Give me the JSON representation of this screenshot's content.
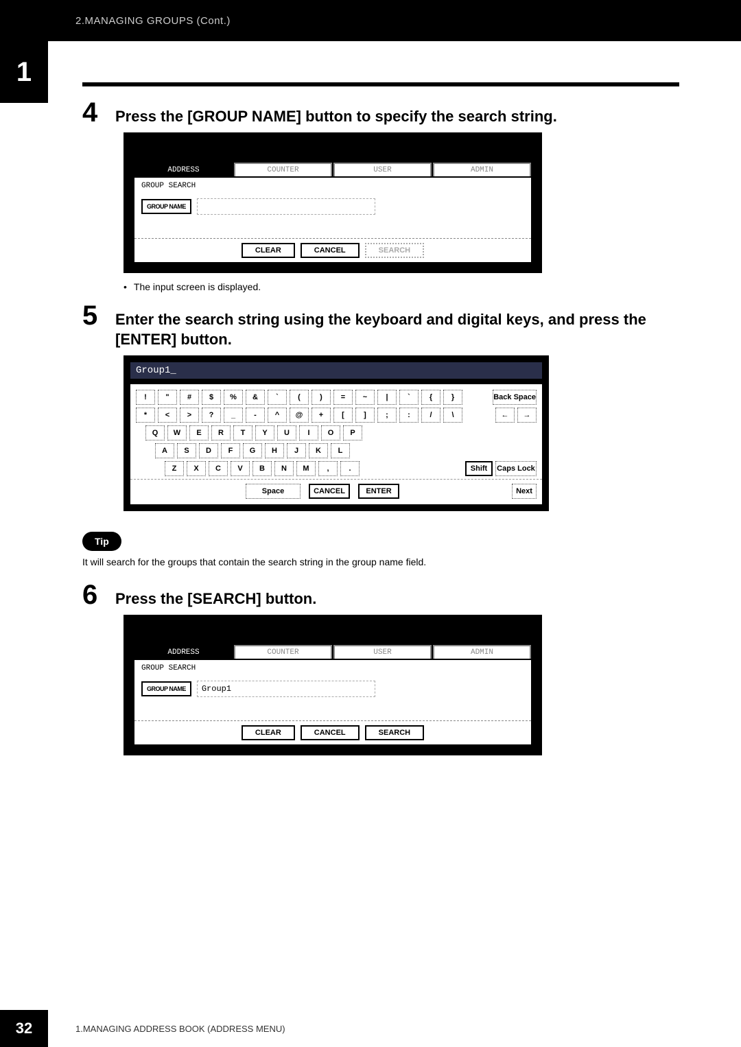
{
  "header": {
    "section_title": "2.MANAGING GROUPS (Cont.)"
  },
  "chapter_tab": "1",
  "steps": {
    "s4": {
      "num": "4",
      "text": "Press the [GROUP NAME] button to specify the search string."
    },
    "s5": {
      "num": "5",
      "text": "Enter the search string using the keyboard and digital keys, and press the [ENTER] button."
    },
    "s6": {
      "num": "6",
      "text": "Press the [SEARCH] button."
    }
  },
  "bullet_after_s4": "The input screen is displayed.",
  "tip": {
    "label": "Tip",
    "text": "It will search for the groups that contain the search string in the group name field."
  },
  "panel": {
    "tabs": {
      "address": "ADDRESS",
      "counter": "COUNTER",
      "user": "USER",
      "admin": "ADMIN"
    },
    "title": "GROUP SEARCH",
    "group_name_btn": "GROUP NAME",
    "group_name_value_empty": "",
    "group_name_value_filled": "Group1",
    "actions": {
      "clear": "CLEAR",
      "cancel": "CANCEL",
      "search": "SEARCH"
    }
  },
  "keyboard": {
    "input_value": "Group1_",
    "row1": [
      "!",
      "\"",
      "#",
      "$",
      "%",
      "&",
      "`",
      "(",
      ")",
      "=",
      "~",
      "|",
      "`",
      "{",
      "}"
    ],
    "row1_right": "Back Space",
    "row2": [
      "*",
      "<",
      ">",
      "?",
      "_",
      "-",
      "^",
      "@",
      "+",
      "[",
      "]",
      ";",
      ":",
      "/",
      "\\"
    ],
    "row2_right": [
      "←",
      "→"
    ],
    "row3": [
      "Q",
      "W",
      "E",
      "R",
      "T",
      "Y",
      "U",
      "I",
      "O",
      "P"
    ],
    "row4": [
      "A",
      "S",
      "D",
      "F",
      "G",
      "H",
      "J",
      "K",
      "L"
    ],
    "row5": [
      "Z",
      "X",
      "C",
      "V",
      "B",
      "N",
      "M",
      ",",
      "."
    ],
    "row5_right": [
      "Shift",
      "Caps Lock"
    ],
    "actions": {
      "space": "Space",
      "cancel": "CANCEL",
      "enter": "ENTER",
      "next": "Next"
    }
  },
  "footer": {
    "page": "32",
    "text": "1.MANAGING ADDRESS BOOK (ADDRESS MENU)"
  }
}
